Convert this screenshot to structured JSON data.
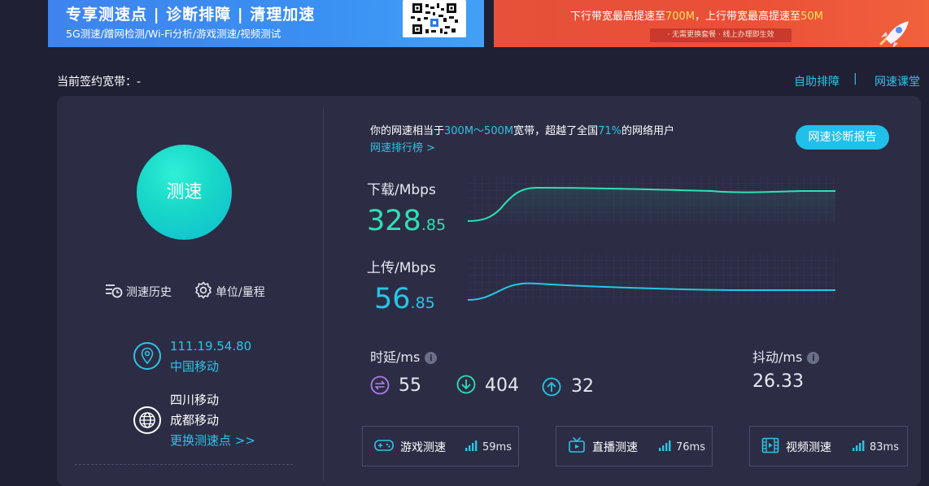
{
  "banner_left": {
    "title": "专享测速点 | 诊断排障 | 清理加速",
    "subtitle": "5G测速/蹭网检测/Wi-Fi分析/游戏测速/视频测试",
    "icon": "qr-code-icon"
  },
  "banner_right": {
    "text_part1": "下行带宽最高提速至",
    "text_value1": "700M",
    "text_part2": "，上行带宽最高提速至",
    "text_value2": "50M",
    "strip": "· 无需更换套餐    · 线上办理即生效",
    "icon": "rocket-icon"
  },
  "header": {
    "bandwidth_label": "当前签约宽带：-",
    "self_diagnose": "自助排障",
    "separator": "|",
    "speed_class": "网速课堂"
  },
  "left_panel": {
    "test_button": "测速",
    "history_label": "测速历史",
    "units_label": "单位/量程",
    "ip": "111.19.54.80",
    "isp": "中国移动",
    "node_region": "四川移动",
    "node_city": "成都移动",
    "change_node": "更换测速点 >>"
  },
  "result": {
    "summary_prefix": "你的网速相当于",
    "summary_range": "300M～500M",
    "summary_mid": "宽带，超越了全国",
    "summary_percent": "71%",
    "summary_suffix": "的网络用户",
    "rank_link": "网速排行榜 >",
    "report_button": "网速诊断报告",
    "download_label": "下载/Mbps",
    "download_int": "328",
    "download_dec": ".85",
    "upload_label": "上传/Mbps",
    "upload_int": "56",
    "upload_dec": ".85",
    "latency_label": "时延/ms",
    "latency_idle": "55",
    "latency_down": "404",
    "latency_up": "32",
    "jitter_label": "抖动/ms",
    "jitter": "26.33",
    "info_glyph": "i"
  },
  "apps": [
    {
      "name": "游戏测速",
      "latency": "59ms",
      "icon": "gamepad-icon"
    },
    {
      "name": "直播测速",
      "latency": "76ms",
      "icon": "tv-icon"
    },
    {
      "name": "视频测速",
      "latency": "83ms",
      "icon": "film-icon"
    }
  ],
  "colors": {
    "background": "#1f2034",
    "card": "#2c2d45",
    "accent_cyan": "#2fc2e6",
    "download_green": "#2ee0b6",
    "upload_cyan": "#23c8e6",
    "latency_purple": "#b07ce6",
    "banner_blue": "#3a8ff2",
    "banner_red": "#eb4f37"
  }
}
